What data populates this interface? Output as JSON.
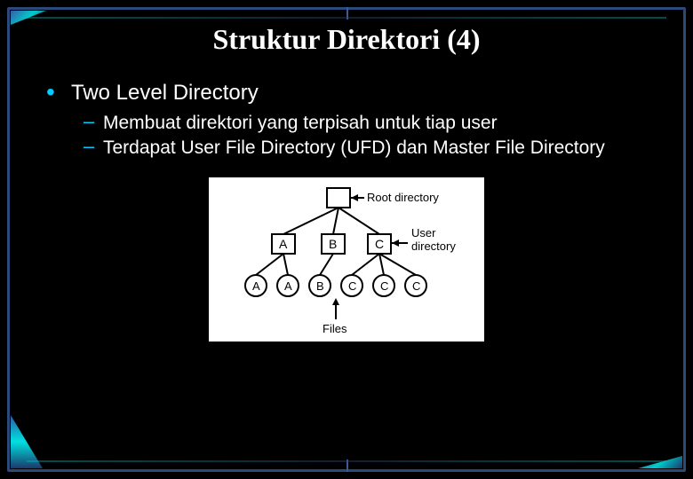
{
  "title": "Struktur Direktori (4)",
  "bullets": {
    "main": "Two Level Directory",
    "subs": [
      "Membuat direktori yang terpisah untuk tiap user",
      "Terdapat User File Directory (UFD) dan Master File Directory"
    ]
  },
  "diagram": {
    "root_label": "Root directory",
    "user_dir_label": "User directory",
    "files_label": "Files",
    "user_dirs": [
      "A",
      "B",
      "C"
    ],
    "files": [
      "A",
      "A",
      "B",
      "C",
      "C",
      "C"
    ]
  }
}
